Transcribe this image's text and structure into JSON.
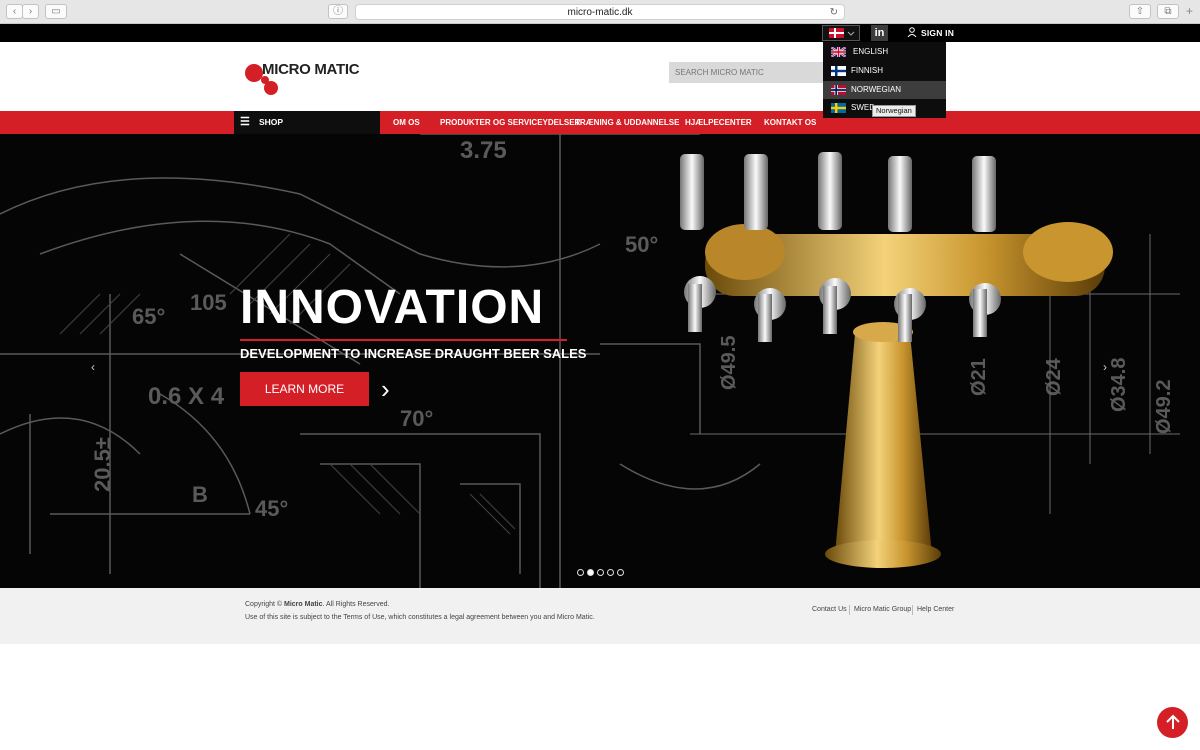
{
  "browser": {
    "url": "micro-matic.dk"
  },
  "topbar": {
    "linkedin_label": "in",
    "signin_label": "SIGN IN"
  },
  "header": {
    "logo_text": "MICRO MATIC",
    "search_placeholder": "SEARCH MICRO MATIC"
  },
  "nav": {
    "shop_label": "SHOP",
    "items": [
      "OM OS",
      "PRODUKTER OG SERVICEYDELSER",
      "TRÆNING & UDDANNELSE",
      "HJÆLPECENTER",
      "KONTAKT OS"
    ]
  },
  "language_menu": {
    "items": [
      {
        "label": "ENGLISH",
        "flag": "uk-flag-icon"
      },
      {
        "label": "FINNISH",
        "flag": "finland-flag-icon"
      },
      {
        "label": "NORWEGIAN",
        "flag": "norway-flag-icon"
      },
      {
        "label": "SWED",
        "flag": "sweden-flag-icon"
      }
    ],
    "tooltip": "Norwegian"
  },
  "hero": {
    "title": "INNOVATION",
    "subtitle": "DEVELOPMENT TO INCREASE DRAUGHT BEER SALES",
    "cta_label": "LEARN MORE",
    "slide_count": 5,
    "active_slide": 2,
    "drawing_labels": [
      "3.75",
      "50°",
      "65°",
      "105",
      "0.6 X 4",
      "70°",
      "20.5±",
      "B",
      "45°",
      "Ø49.5",
      "Ø21",
      "Ø24",
      "Ø34.8",
      "Ø49.2"
    ]
  },
  "footer": {
    "copyright_prefix": "Copyright © ",
    "copyright_brand": "Micro Matic",
    "copyright_suffix": ". All Rights Reserved.",
    "terms": "Use of this site is subject to the Terms of Use, which constitutes a legal agreement between you and Micro Matic.",
    "links": [
      "Contact Us",
      "Micro Matic Group",
      "Help Center"
    ]
  },
  "colors": {
    "brand_red": "#d41f26",
    "black": "#000000"
  }
}
